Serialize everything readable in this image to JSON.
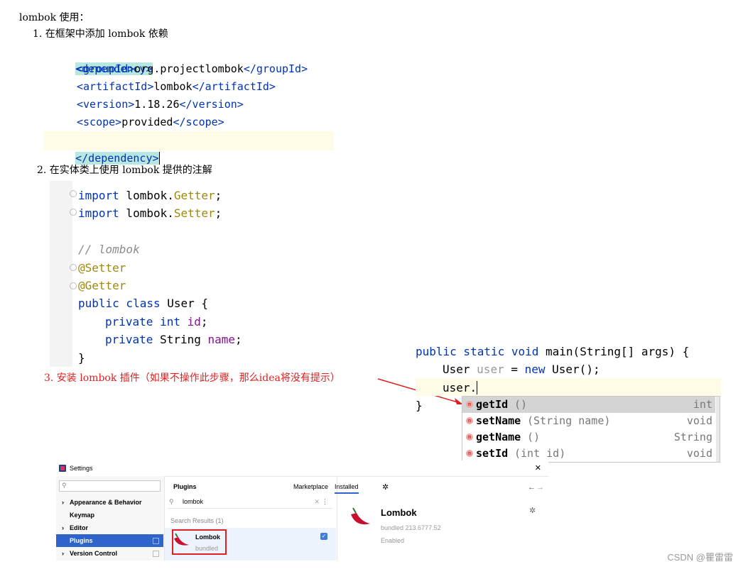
{
  "heading": "lombok 使用：",
  "steps": {
    "step1": "1. 在框架中添加 lombok 依赖",
    "step2": "2. 在实体类上使用 lombok 提供的注解",
    "step3": "3. 安装 lombok 插件（如果不操作此步骤，那么idea将没有提示）"
  },
  "xml": {
    "open_dependency": "<dependency>",
    "groupId_open": "<groupId>",
    "groupId_value": "org.projectlombok",
    "groupId_close": "</groupId>",
    "artifactId_open": "<artifactId>",
    "artifactId_value": "lombok",
    "artifactId_close": "</artifactId>",
    "version_open": "<version>",
    "version_value": "1.18.26",
    "version_close": "</version>",
    "scope_open": "<scope>",
    "scope_value": "provided",
    "scope_close": "</scope>",
    "close_dependency": "</dependency>"
  },
  "java_entity": {
    "import_kw": "import",
    "import1_pkg": " lombok.",
    "import1_cls": "Getter",
    "import1_end": ";",
    "import2_pkg": " lombok.",
    "import2_cls": "Setter",
    "import2_end": ";",
    "comment": "// lombok",
    "ann_setter": "@Setter",
    "ann_getter": "@Getter",
    "class_kw": "public class",
    "class_name": " User {",
    "field_kw": "private",
    "field1_type": " int ",
    "field1_name": "id",
    "field1_end": ";",
    "field2_type": " String ",
    "field2_name": "name",
    "field2_end": ";",
    "close_brace": "}"
  },
  "java_main": {
    "sig_kw": "public static void",
    "sig_rest": " main(String[] args) {",
    "l2_type": "User ",
    "l2_var": "user",
    "l2_mid": " = ",
    "l2_new": "new",
    "l2_end": " User();",
    "l3": "user.",
    "close_brace": "}"
  },
  "completion": [
    {
      "name": "getId",
      "params": "()",
      "ret": "int"
    },
    {
      "name": "setName",
      "params": "(String name)",
      "ret": "void"
    },
    {
      "name": "getName",
      "params": "()",
      "ret": "String"
    },
    {
      "name": "setId",
      "params": "(int id)",
      "ret": "void"
    }
  ],
  "completion_icon": "m",
  "settings": {
    "title": "Settings",
    "close": "✕",
    "nav": [
      {
        "label": "Appearance & Behavior",
        "arrow": "›"
      },
      {
        "label": "Keymap",
        "arrow": ""
      },
      {
        "label": "Editor",
        "arrow": "›"
      },
      {
        "label": "Plugins",
        "arrow": ""
      },
      {
        "label": "Version Control",
        "arrow": "›"
      }
    ],
    "plugins_header": "Plugins",
    "tab_marketplace": "Marketplace",
    "tab_installed": "Installed",
    "search_value": "lombok",
    "search_results": "Search Results (1)",
    "plugin_name": "Lombok",
    "plugin_sub": "bundled",
    "detail_name": "Lombok",
    "detail_version": "bundled 213.6777.52",
    "detail_status": "Enabled"
  },
  "watermark": "CSDN @瞿雷雷",
  "colors": {
    "tag": "#0033b3",
    "keyword": "#0033b3",
    "annotation": "#9e880d",
    "field": "#871094",
    "step3": "#e02020",
    "accent": "#2f65ca"
  }
}
